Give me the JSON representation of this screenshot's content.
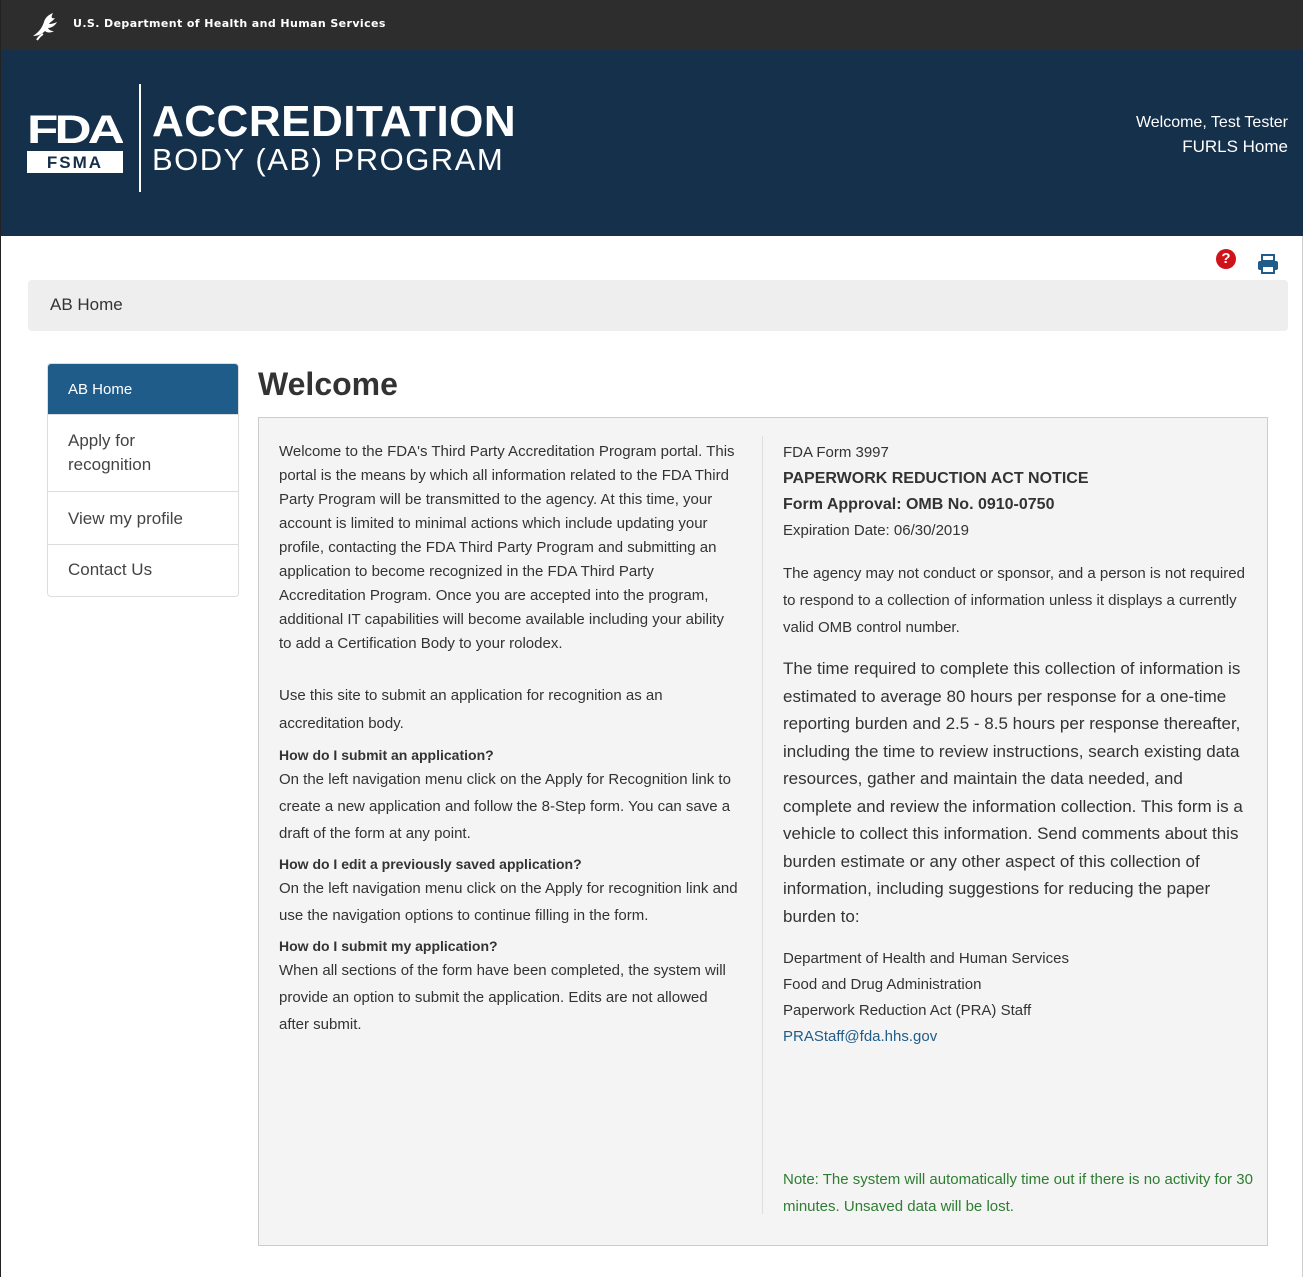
{
  "hhs_bar": {
    "text": "U.S. Department of Health and Human Services",
    "icon": "hhs-eagle-icon"
  },
  "header": {
    "logo_text_top": "FDA",
    "logo_text_bottom": "FSMA",
    "title_line1": "ACCREDITATION",
    "title_line2": "BODY (AB) PROGRAM",
    "welcome": "Welcome, Test Tester",
    "furls_home": "FURLS Home",
    "background": "#14304b"
  },
  "utility": {
    "help_icon": "question-circle-icon",
    "help_glyph": "?",
    "print_icon": "print-icon"
  },
  "breadcrumb": {
    "current": "AB Home"
  },
  "sidebar": {
    "items": [
      {
        "label": "AB Home",
        "active": true
      },
      {
        "label": "Apply for recognition",
        "line1": "Apply for",
        "line2": "recognition"
      },
      {
        "label": "View my profile"
      },
      {
        "label": "Contact Us"
      }
    ],
    "active_color": "#1f5c89"
  },
  "main": {
    "title": "Welcome",
    "intro": "Welcome to the FDA's Third Party Accreditation Program portal. This portal is the means by which all information related to the FDA Third Party Program will be transmitted to the agency. At this time, your account is limited to minimal actions which include updating your profile, contacting the FDA Third Party Program and submitting an application to become recognized in the FDA Third Party Accreditation Program. Once you are accepted into the program, additional IT capabilities will become available including your ability to add a Certification Body to your rolodex.",
    "use_site": "Use this site to submit an application for recognition as an accreditation body.",
    "faq": [
      {
        "q": "How do I submit an application?",
        "a": "On the left navigation menu click on the Apply for Recognition link to create a new application and follow the 8-Step form. You can save a draft of the form at any point."
      },
      {
        "q": "How do I edit a previously saved application?",
        "a": "On the left navigation menu click on the Apply for recognition link and use the navigation options to continue filling in the form."
      },
      {
        "q": "How do I submit my application?",
        "a": "When all sections of the form have been completed, the system will provide an option to submit the application. Edits are not allowed after submit."
      }
    ],
    "form_number": "FDA Form 3997",
    "pra_title": "PAPERWORK REDUCTION ACT NOTICE",
    "form_approval": "Form Approval: OMB No. 0910-0750",
    "expiration": "Expiration Date: 06/30/2019",
    "agency_note": "The agency may not conduct or sponsor, and a person is not required to respond to a collection of information unless it displays a currently valid OMB control number.",
    "burden": "The time required to complete this collection of information is estimated to average 80 hours per response for a one-time reporting burden and 2.5 - 8.5 hours per response thereafter, including the time to review instructions, search existing data resources, gather and maintain the data needed, and complete and review the information collection. This form is a vehicle to collect this information. Send comments about this burden estimate or any other aspect of this collection of information, including suggestions for reducing the paper burden to:",
    "address_lines": [
      "Department of Health and Human Services",
      "Food and Drug Administration",
      "Paperwork Reduction Act (PRA) Staff"
    ],
    "email": "PRAStaff@fda.hhs.gov",
    "timeout_note": "Note: The system will automatically time out if there is no activity for 30 minutes. Unsaved data will be lost.",
    "note_color": "#2e7d32"
  }
}
